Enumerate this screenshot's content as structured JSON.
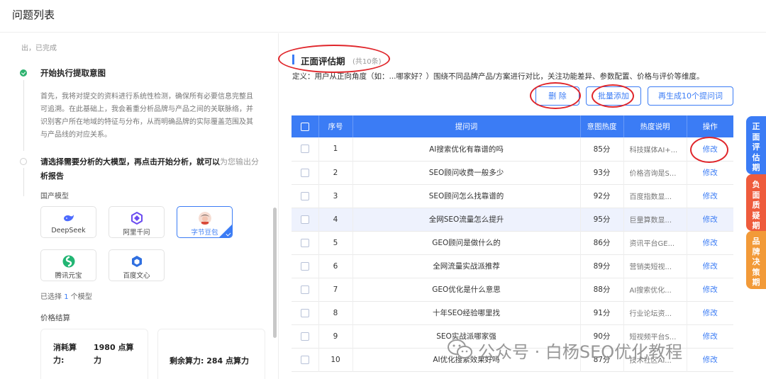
{
  "window": {
    "title": "问题列表"
  },
  "left_panel": {
    "cut_text": "出，已完成",
    "step1": {
      "title": "开始执行提取意图",
      "lines": [
        "首先，我将对提交的资料进行系统性检测，确保所有必要信息完整且",
        "可追溯。在此基础上，我会着重分析品牌与产品之间的关联脉络，并",
        "识别客户所在地域的特征与分布，从而明确品牌的实际覆盖范围及其",
        "与产品线的对应关系。"
      ]
    },
    "step2": {
      "title_dark": "请选择需要分析的大模型，再点击开始分析，就可以",
      "title_light": "为您输出分",
      "title_line2": "析报告"
    },
    "domestic_label": "国产模型",
    "models": [
      {
        "name": "DeepSeek",
        "icon": "whale-icon",
        "color": "#4d6bfe",
        "selected": false
      },
      {
        "name": "阿里千问",
        "icon": "qwen-icon",
        "color": "#6b4cf0",
        "selected": false
      },
      {
        "name": "字节豆包",
        "icon": "doubao-avatar-icon",
        "color": "#f2b8a8",
        "selected": true
      },
      {
        "name": "腾讯元宝",
        "icon": "yuanbao-icon",
        "color": "#22b573",
        "selected": false
      },
      {
        "name": "百度文心",
        "icon": "wenxin-icon",
        "color": "#2f6fe0",
        "selected": false
      }
    ],
    "selected_prefix": "已选择",
    "selected_count": "1",
    "selected_suffix": "个模型",
    "price_label": "价格结算",
    "consumed_label_1": "消耗算",
    "consumed_label_2": "力:",
    "consumed_value_1": "1980 点算",
    "consumed_value_2": "力",
    "remaining_label": "剩余算力:",
    "remaining_value": "284 点算力"
  },
  "section": {
    "title": "正面评估期",
    "count": "(共10条)",
    "definition": "定义：用户从正向角度（如：...哪家好？）围绕不同品牌产品/方案进行对比，关注功能差异、参数配置、价格与评价等维度。"
  },
  "buttons": {
    "delete": "删 除",
    "batch_add": "批量添加",
    "regenerate": "再生成10个提问词"
  },
  "table": {
    "headers": [
      "",
      "序号",
      "提问词",
      "意图热度",
      "热度说明",
      "操作"
    ],
    "edit_label": "修改",
    "rows": [
      {
        "no": "1",
        "keyword": "AI搜索优化有靠谱的吗",
        "heat": "85分",
        "desc": "科技媒体AI+..."
      },
      {
        "no": "2",
        "keyword": "SEO顾问收费一般多少",
        "heat": "93分",
        "desc": "价格咨询是S..."
      },
      {
        "no": "3",
        "keyword": "SEO顾问怎么找靠谱的",
        "heat": "92分",
        "desc": "百度指数显..."
      },
      {
        "no": "4",
        "keyword": "全网SEO流量怎么提升",
        "heat": "95分",
        "desc": "巨量算数显..."
      },
      {
        "no": "5",
        "keyword": "GEO顾问是做什么的",
        "heat": "86分",
        "desc": "资讯平台GE..."
      },
      {
        "no": "6",
        "keyword": "全网流量实战派推荐",
        "heat": "89分",
        "desc": "营销类短视..."
      },
      {
        "no": "7",
        "keyword": "GEO优化是什么意思",
        "heat": "88分",
        "desc": "AI搜索优化..."
      },
      {
        "no": "8",
        "keyword": "十年SEO经验哪里找",
        "heat": "91分",
        "desc": "行业论坛资..."
      },
      {
        "no": "9",
        "keyword": "SEO实战派哪家强",
        "heat": "90分",
        "desc": "短视频平台S..."
      },
      {
        "no": "10",
        "keyword": "AI优化搜索效果好吗",
        "heat": "87分",
        "desc": "技术社区AI..."
      }
    ]
  },
  "side_tabs": [
    {
      "label": [
        "正",
        "面",
        "评",
        "估",
        "期"
      ],
      "color": "#3b7cf5"
    },
    {
      "label": [
        "负",
        "面",
        "质",
        "疑",
        "期"
      ],
      "color": "#ee5b3c"
    },
    {
      "label": [
        "品",
        "牌",
        "决",
        "策",
        "期"
      ],
      "color": "#f29a38"
    }
  ],
  "watermark": "公众号 · 白杨SEO优化教程"
}
